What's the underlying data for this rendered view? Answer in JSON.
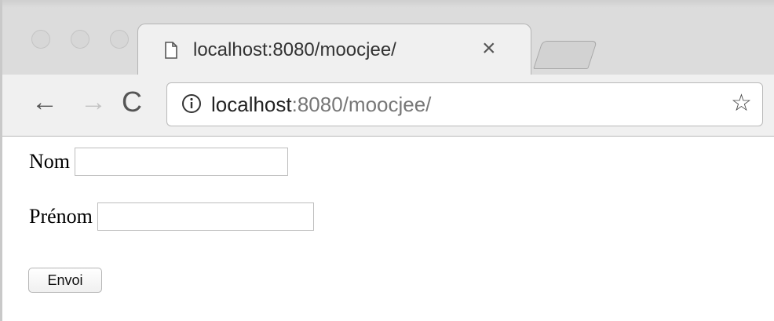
{
  "browser": {
    "tab": {
      "title": "localhost:8080/moocjee/",
      "close_glyph": "×",
      "page_icon": "page-icon"
    },
    "new_tab_icon": "new-tab-icon",
    "toolbar": {
      "back_glyph": "←",
      "forward_glyph": "→",
      "reload_glyph": "C",
      "url_host": "localhost",
      "url_rest": ":8080/moocjee/",
      "info_icon": "info-icon",
      "star_glyph": "☆"
    }
  },
  "form": {
    "nom_label": "Nom",
    "nom_value": "",
    "prenom_label": "Prénom",
    "prenom_value": "",
    "submit_label": "Envoi"
  }
}
